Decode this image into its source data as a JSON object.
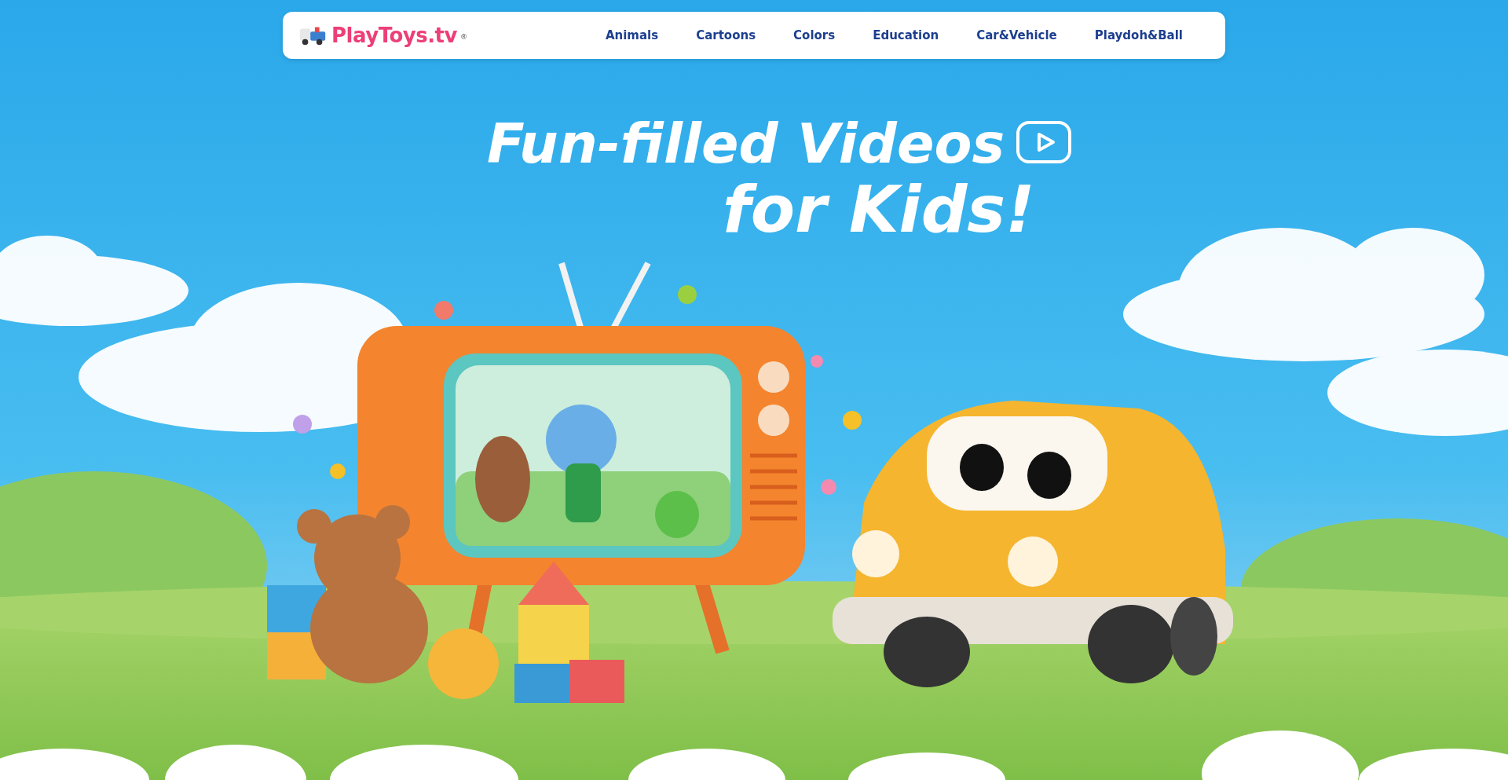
{
  "nav": {
    "logo": "PlayToys.tv",
    "logo_mark": "®",
    "links": [
      "Animals",
      "Cartoons",
      "Colors",
      "Education",
      "Car&Vehicle",
      "Playdoh&Ball"
    ]
  },
  "hero": {
    "headline_lines": [
      "Fun-filled Videos",
      "for Kids!"
    ]
  }
}
